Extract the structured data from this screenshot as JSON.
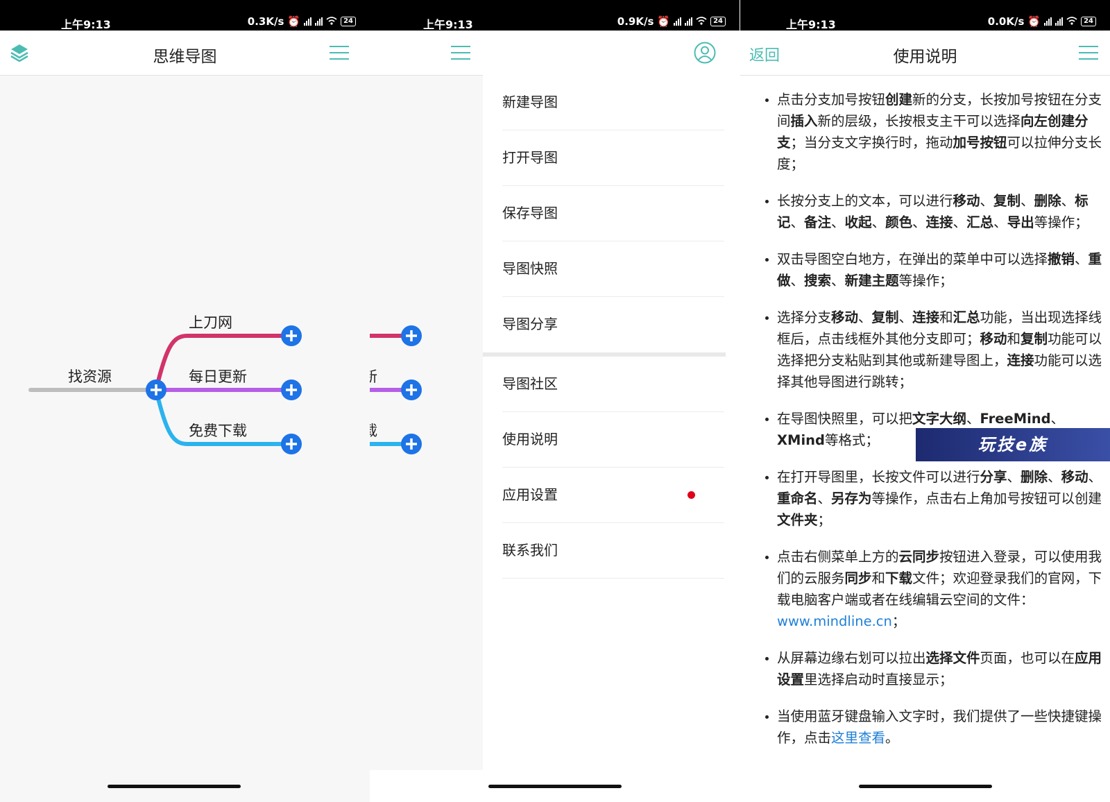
{
  "status_bars": [
    {
      "time": "上午9:13",
      "speed": "0.3K/s",
      "battery": "24"
    },
    {
      "time": "上午9:13",
      "speed": "0.9K/s",
      "battery": "24"
    },
    {
      "time": "上午9:13",
      "speed": "0.0K/s",
      "battery": "24"
    }
  ],
  "panel1": {
    "title": "思维导图",
    "root_label": "找资源",
    "branches": [
      {
        "label": "上刀网",
        "color": "#d2336a"
      },
      {
        "label": "每日更新",
        "color": "#b65ee6"
      },
      {
        "label": "免费下载",
        "color": "#2bb3ee"
      }
    ],
    "colors": {
      "plus": "#1e73e6",
      "root_line": "#bdbdbd"
    }
  },
  "panel2": {
    "peek_labels": [
      "新",
      "载"
    ],
    "menu_top": [
      "新建导图",
      "打开导图",
      "保存导图",
      "导图快照",
      "导图分享"
    ],
    "menu_bottom": [
      "导图社区",
      "使用说明",
      "应用设置",
      "联系我们"
    ]
  },
  "panel3": {
    "back_label": "返回",
    "title": "使用说明",
    "watermark": "玩技e族",
    "items": [
      [
        {
          "t": "点击分支加号按钮"
        },
        {
          "t": "创建",
          "b": true
        },
        {
          "t": "新的分支，长按加号按钮在分支间"
        },
        {
          "t": "插入",
          "b": true
        },
        {
          "t": "新的层级，长按根支主干可以选择"
        },
        {
          "t": "向左创建分支",
          "b": true
        },
        {
          "t": "；当分支文字换行时，拖动"
        },
        {
          "t": "加号按钮",
          "b": true
        },
        {
          "t": "可以拉伸分支长度；"
        }
      ],
      [
        {
          "t": "长按分支上的文本，可以进行"
        },
        {
          "t": "移动",
          "b": true
        },
        {
          "t": "、"
        },
        {
          "t": "复制",
          "b": true
        },
        {
          "t": "、"
        },
        {
          "t": "删除",
          "b": true
        },
        {
          "t": "、"
        },
        {
          "t": "标记",
          "b": true
        },
        {
          "t": "、"
        },
        {
          "t": "备注",
          "b": true
        },
        {
          "t": "、"
        },
        {
          "t": "收起",
          "b": true
        },
        {
          "t": "、"
        },
        {
          "t": "颜色",
          "b": true
        },
        {
          "t": "、"
        },
        {
          "t": "连接",
          "b": true
        },
        {
          "t": "、"
        },
        {
          "t": "汇总",
          "b": true
        },
        {
          "t": "、"
        },
        {
          "t": "导出",
          "b": true
        },
        {
          "t": "等操作；"
        }
      ],
      [
        {
          "t": "双击导图空白地方，在弹出的菜单中可以选择"
        },
        {
          "t": "撤销",
          "b": true
        },
        {
          "t": "、"
        },
        {
          "t": "重做",
          "b": true
        },
        {
          "t": "、"
        },
        {
          "t": "搜索",
          "b": true
        },
        {
          "t": "、"
        },
        {
          "t": "新建主题",
          "b": true
        },
        {
          "t": "等操作；"
        }
      ],
      [
        {
          "t": "选择分支"
        },
        {
          "t": "移动",
          "b": true
        },
        {
          "t": "、"
        },
        {
          "t": "复制",
          "b": true
        },
        {
          "t": "、"
        },
        {
          "t": "连接",
          "b": true
        },
        {
          "t": "和"
        },
        {
          "t": "汇总",
          "b": true
        },
        {
          "t": "功能，当出现选择线框后，点击线框外其他分支即可；"
        },
        {
          "t": "移动",
          "b": true
        },
        {
          "t": "和"
        },
        {
          "t": "复制",
          "b": true
        },
        {
          "t": "功能可以选择把分支粘贴到其他或新建导图上，"
        },
        {
          "t": "连接",
          "b": true
        },
        {
          "t": "功能可以选择其他导图进行跳转；"
        }
      ],
      [
        {
          "t": "在导图快照里，可以把"
        },
        {
          "t": "文字大纲",
          "b": true
        },
        {
          "t": "、"
        },
        {
          "t": "FreeMind",
          "b": true
        },
        {
          "t": "、"
        },
        {
          "t": "XMind",
          "b": true
        },
        {
          "t": "等格式；"
        }
      ],
      [
        {
          "t": "在打开导图里，长按文件可以进行"
        },
        {
          "t": "分享",
          "b": true
        },
        {
          "t": "、"
        },
        {
          "t": "删除",
          "b": true
        },
        {
          "t": "、"
        },
        {
          "t": "移动",
          "b": true
        },
        {
          "t": "、"
        },
        {
          "t": "重命名",
          "b": true
        },
        {
          "t": "、"
        },
        {
          "t": "另存为",
          "b": true
        },
        {
          "t": "等操作，点击右上角加号按钮可以创建"
        },
        {
          "t": "文件夹",
          "b": true
        },
        {
          "t": "；"
        }
      ],
      [
        {
          "t": "点击右侧菜单上方的"
        },
        {
          "t": "云同步",
          "b": true
        },
        {
          "t": "按钮进入登录，可以使用我们的云服务"
        },
        {
          "t": "同步",
          "b": true
        },
        {
          "t": "和"
        },
        {
          "t": "下载",
          "b": true
        },
        {
          "t": "文件；欢迎登录我们的官网，下载电脑客户端或者在线编辑云空间的文件："
        },
        {
          "t": "www.mindline.cn",
          "link": true
        },
        {
          "t": "；"
        }
      ],
      [
        {
          "t": "从屏幕边缘右划可以拉出"
        },
        {
          "t": "选择文件",
          "b": true
        },
        {
          "t": "页面，也可以在"
        },
        {
          "t": "应用设置",
          "b": true
        },
        {
          "t": "里选择启动时直接显示；"
        }
      ],
      [
        {
          "t": "当使用蓝牙键盘输入文字时，我们提供了一些快捷键操作，点击"
        },
        {
          "t": "这里查看",
          "link": true
        },
        {
          "t": "。"
        }
      ]
    ]
  }
}
